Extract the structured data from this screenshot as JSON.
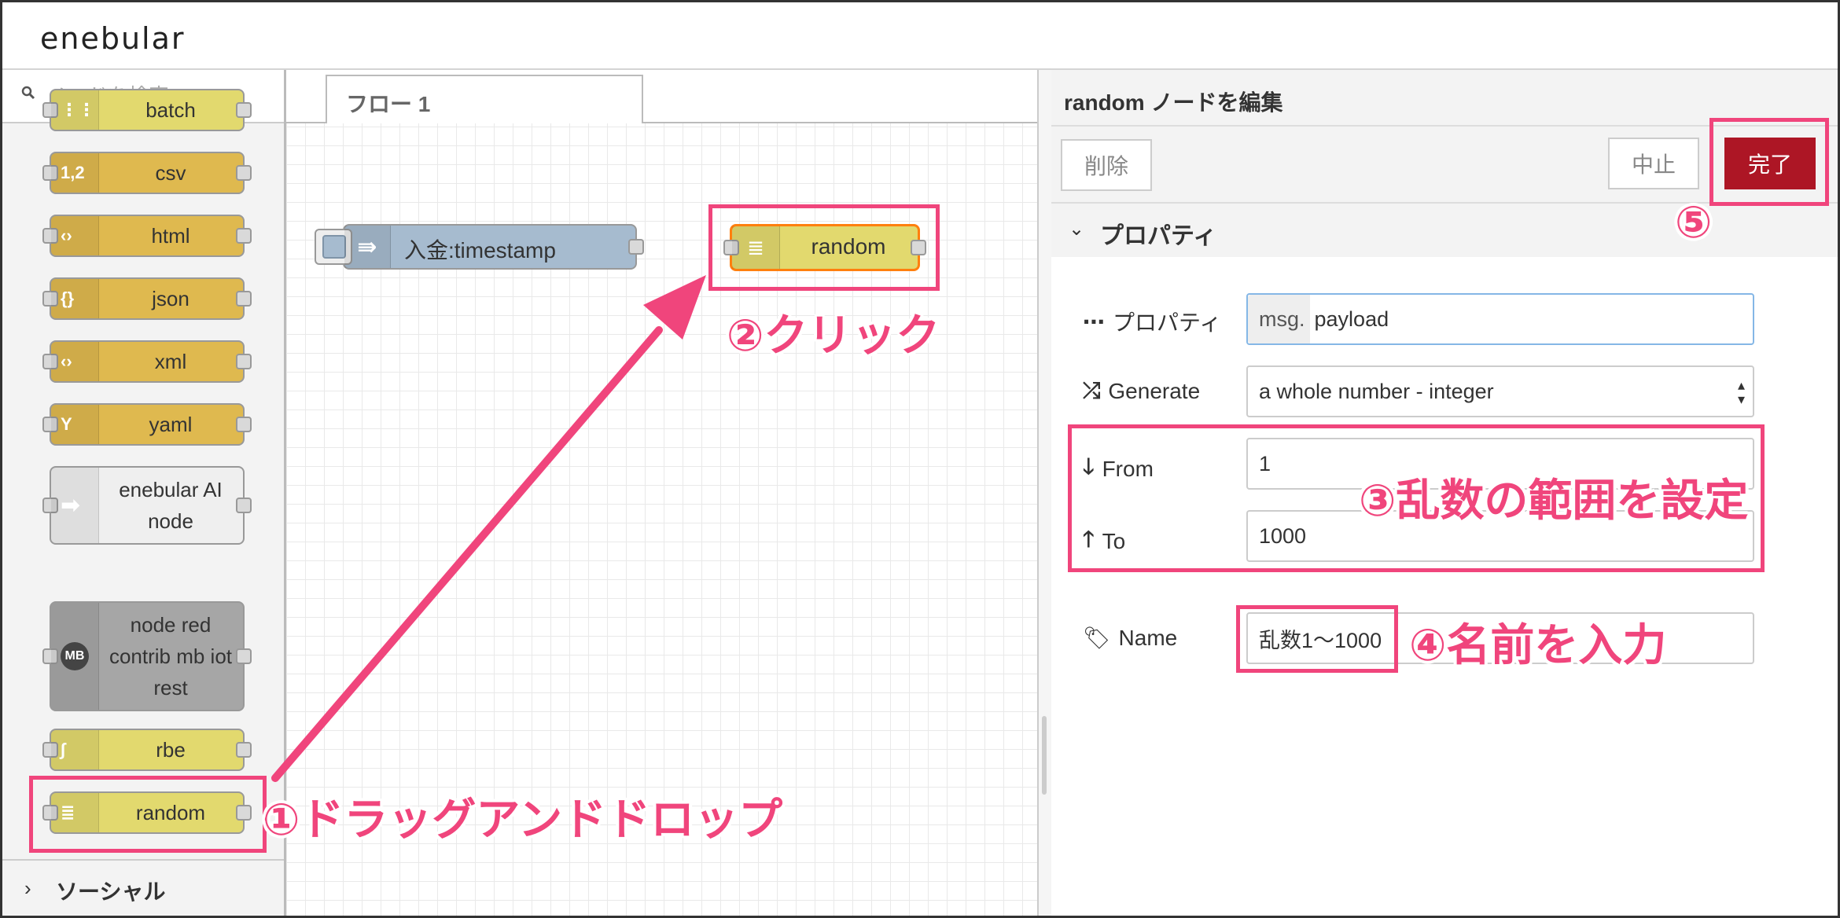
{
  "header": {
    "logo": "enebular"
  },
  "palette": {
    "search_placeholder": "ノードを検索",
    "nodes": [
      {
        "label": "batch",
        "icon": "batch-icon",
        "color": "#e2d96e"
      },
      {
        "label": "csv",
        "icon": "csv-icon",
        "color": "#dfb94f"
      },
      {
        "label": "html",
        "icon": "html-icon",
        "color": "#dfb94f"
      },
      {
        "label": "json",
        "icon": "json-icon",
        "color": "#dfb94f"
      },
      {
        "label": "xml",
        "icon": "xml-icon",
        "color": "#dfb94f"
      },
      {
        "label": "yaml",
        "icon": "yaml-icon",
        "color": "#dfb94f"
      },
      {
        "label": "enebular AI node",
        "icon": "arrow-icon",
        "color": "#efefef"
      },
      {
        "label": "node red contrib mb iot rest",
        "icon": "mb-icon",
        "color": "#a6a6a6"
      },
      {
        "label": "rbe",
        "icon": "rbe-icon",
        "color": "#e2d96e"
      },
      {
        "label": "random",
        "icon": "random-icon",
        "color": "#e2d96e"
      }
    ],
    "category": "ソーシャル"
  },
  "workspace": {
    "tab": "フロー 1",
    "inject_node": "入金:timestamp",
    "random_node": "random"
  },
  "editor": {
    "title": "random ノードを編集",
    "delete_label": "削除",
    "cancel_label": "中止",
    "done_label": "完了",
    "section": "プロパティ",
    "property_label": "プロパティ",
    "property_prefix": "msg.",
    "property_value": "payload",
    "generate_label": "Generate",
    "generate_value": "a whole number - integer",
    "from_label": "From",
    "from_value": "1",
    "to_label": "To",
    "to_value": "1000",
    "name_label": "Name",
    "name_value": "乱数1〜1000"
  },
  "annotations": {
    "step1": "①ドラッグアンドドロップ",
    "step2": "②クリック",
    "step3": "③乱数の範囲を設定",
    "step4": "④名前を入力",
    "step5": "⑤"
  },
  "colors": {
    "accent": "#f0457c",
    "primary": "#ad1625"
  }
}
